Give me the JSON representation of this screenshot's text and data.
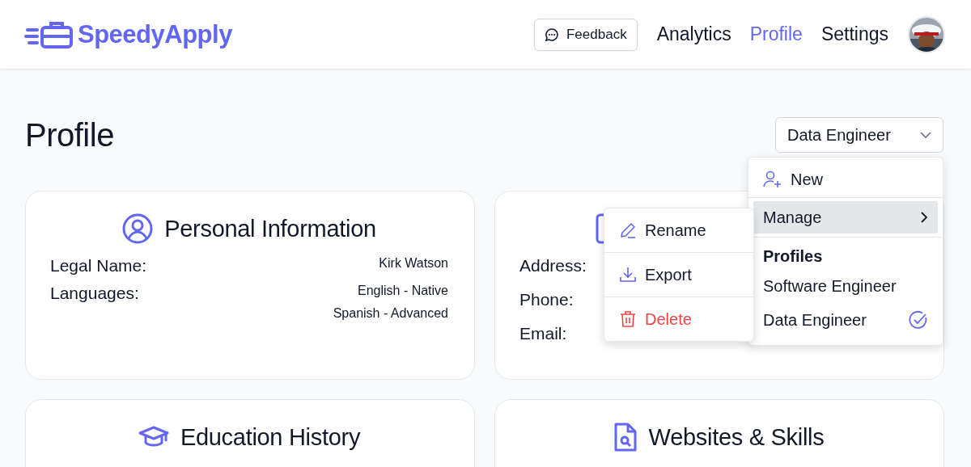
{
  "header": {
    "logo": "SpeedyApply",
    "feedback_button": "Feedback",
    "nav": [
      {
        "label": "Analytics",
        "selected": false
      },
      {
        "label": "Profile",
        "selected": true
      },
      {
        "label": "Settings",
        "selected": false
      }
    ]
  },
  "page_title": "Profile",
  "profile_select": {
    "value": "Data Engineer"
  },
  "cards": [
    {
      "kind": "personal",
      "title": "Personal Information",
      "rows": [
        {
          "label": "Legal Name:",
          "values": [
            "Kirk Watson"
          ]
        },
        {
          "label": "Languages:",
          "values": [
            "English - Native",
            "Spanish - Advanced"
          ]
        }
      ]
    },
    {
      "kind": "contact",
      "rows": [
        {
          "label": "Address:"
        },
        {
          "label": "Phone:"
        },
        {
          "label": "Email:"
        }
      ]
    },
    {
      "kind": "education",
      "title": "Education History"
    },
    {
      "kind": "websites",
      "title": "Websites & Skills"
    }
  ],
  "profile_menu": {
    "new": "New",
    "manage": {
      "label": "Manage",
      "expanded": true
    },
    "section": "Profiles",
    "profiles": [
      {
        "name": "Software Engineer",
        "selected": false
      },
      {
        "name": "Data Engineer",
        "selected": true
      }
    ]
  },
  "manage_menu": [
    {
      "kind": "rename",
      "label": "Rename"
    },
    {
      "kind": "export",
      "label": "Export"
    },
    {
      "kind": "delete",
      "label": "Delete"
    }
  ]
}
